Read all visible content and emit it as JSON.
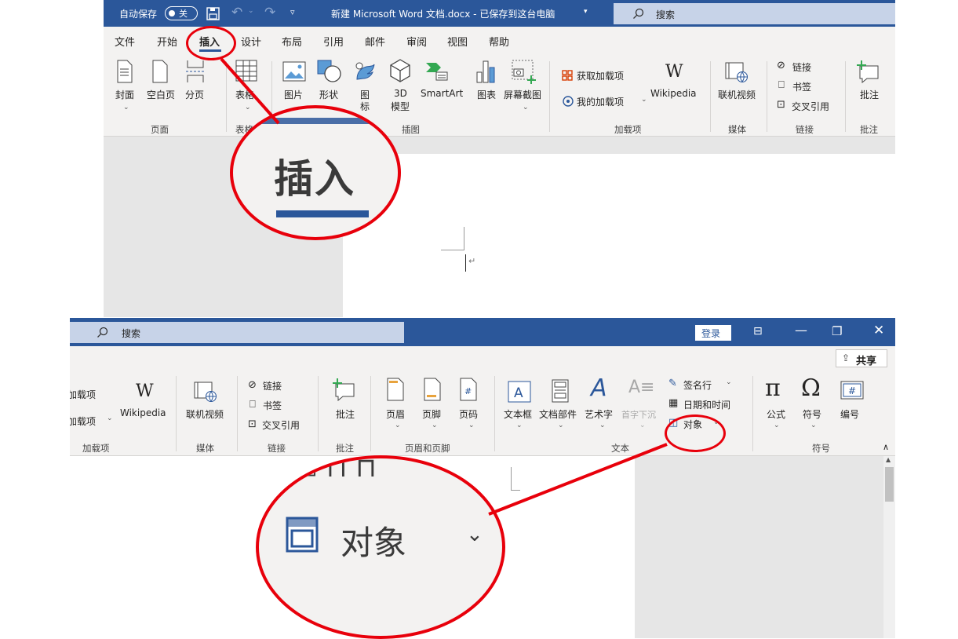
{
  "top": {
    "titlebar": {
      "autosave_label": "自动保存",
      "autosave_state": "关",
      "doc_title": "新建 Microsoft Word 文档.docx - 已保存到这台电脑",
      "search_placeholder": "搜索"
    },
    "tabs": [
      "文件",
      "开始",
      "插入",
      "设计",
      "布局",
      "引用",
      "邮件",
      "审阅",
      "视图",
      "帮助"
    ],
    "active_tab": "插入",
    "pages_group": {
      "items": [
        "封面",
        "空白页",
        "分页"
      ],
      "label": "页面"
    },
    "tables_group": {
      "items": [
        "表格"
      ],
      "label": "表格"
    },
    "illustrations_group": {
      "items": [
        "图片",
        "形状",
        "图",
        "标",
        "3D",
        "模型",
        "SmartArt",
        "图表",
        "屏幕截图"
      ],
      "label": "插图"
    },
    "addins_group": {
      "get_addins": "获取加载项",
      "my_addins": "我的加载项",
      "wikipedia": "Wikipedia",
      "label": "加载项"
    },
    "media_group": {
      "item": "联机视频",
      "label": "媒体"
    },
    "links_group": {
      "items": [
        "链接",
        "书签",
        "交叉引用"
      ],
      "label": "链接"
    },
    "comments_group": {
      "item": "批注",
      "label": "批注"
    },
    "zoom_text": "插入"
  },
  "bottom": {
    "titlebar": {
      "search_placeholder": "搜索",
      "login": "登录"
    },
    "share": "共享",
    "addins_group": {
      "get_addins_partial": "加载项",
      "my_addins_partial": "加载项",
      "wikipedia": "Wikipedia",
      "label": "加载项"
    },
    "media_group": {
      "item": "联机视频",
      "label": "媒体"
    },
    "links_group": {
      "items": [
        "链接",
        "书签",
        "交叉引用"
      ],
      "label": "链接"
    },
    "comments_group": {
      "item": "批注",
      "label": "批注"
    },
    "header_footer_group": {
      "items": [
        "页眉",
        "页脚",
        "页码"
      ],
      "label": "页眉和页脚"
    },
    "text_group": {
      "items": [
        "文本框",
        "文档部件",
        "艺术字",
        "首字下沉"
      ],
      "signature": "签名行",
      "datetime": "日期和时间",
      "object": "对象",
      "label": "文本"
    },
    "symbols_group": {
      "items": [
        "公式",
        "符号",
        "编号"
      ],
      "label": "符号"
    },
    "zoom_text": "对象"
  },
  "colors": {
    "word_blue": "#2b579a",
    "ribbon_bg": "#f3f2f1",
    "annotation_red": "#e8000b"
  }
}
